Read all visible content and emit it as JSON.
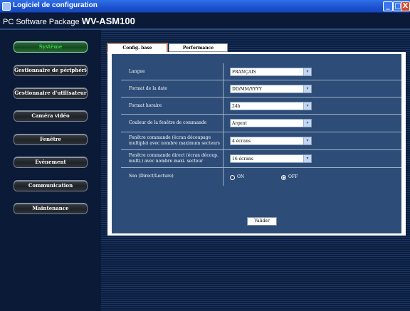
{
  "window": {
    "title": "Logiciel de configuration",
    "controls": {
      "minimize": "_",
      "maximize": "□",
      "close": "X"
    }
  },
  "header": {
    "package_prefix": "PC Software Package",
    "package_name": "WV-ASM100"
  },
  "sidebar": {
    "items": [
      {
        "label": "Système",
        "active": true
      },
      {
        "label": "Gestionnaire de périphérique",
        "active": false
      },
      {
        "label": "Gestionnaire d'utilisateur",
        "active": false
      },
      {
        "label": "Caméra vidéo",
        "active": false
      },
      {
        "label": "Fenêtre",
        "active": false
      },
      {
        "label": "Evénement",
        "active": false
      },
      {
        "label": "Communication",
        "active": false
      },
      {
        "label": "Maintenance",
        "active": false
      }
    ]
  },
  "tabs": [
    {
      "label": "Config. base",
      "active": true
    },
    {
      "label": "Performance",
      "active": false
    }
  ],
  "form": {
    "rows": [
      {
        "label": "Langue",
        "value": "FRANÇAIS"
      },
      {
        "label": "Format de la date",
        "value": "DD/MM/YYYY"
      },
      {
        "label": "Format horaire",
        "value": "24h"
      },
      {
        "label": "Couleur de la fenêtre de commande",
        "value": "Argent"
      },
      {
        "label": "Fenêtre commande (écran découpage multiple) avec nombre maximum secteurs",
        "value": "4 écrans"
      },
      {
        "label": "Fenêtre commande direct (écran découp. multi.) avec nombre maxi. secteur",
        "value": "16 écrans"
      }
    ],
    "sound": {
      "label": "Son (Direct/Lecture)",
      "options": [
        {
          "label": "ON",
          "selected": false
        },
        {
          "label": "OFF",
          "selected": true
        }
      ]
    },
    "submit_label": "Valider"
  },
  "colors": {
    "title_bar": "#1c52d0",
    "background": "#0a1a37",
    "panel": "#2d4d78",
    "active_nav_text": "#39d44b"
  }
}
